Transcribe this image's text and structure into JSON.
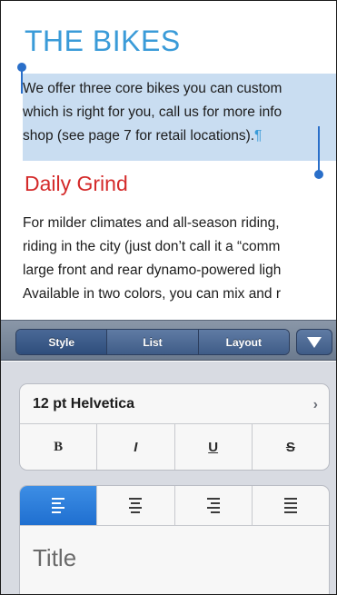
{
  "document": {
    "title": "THE BIKES",
    "paragraph1": [
      "We offer three core bikes you can custom",
      "which is right for you, call us for more info",
      "shop (see page 7 for retail locations)."
    ],
    "pilcrow": "¶",
    "heading": "Daily Grind",
    "paragraph2": [
      "For milder climates and all-season riding,",
      "riding in the city (just don’t call it a “comm",
      "large front and rear dynamo-powered ligh",
      "Available in two colors, you can mix and r"
    ]
  },
  "toolbar": {
    "tabs": [
      {
        "label": "Style",
        "active": true
      },
      {
        "label": "List",
        "active": false
      },
      {
        "label": "Layout",
        "active": false
      }
    ],
    "dropdown_icon": "triangle-down-icon"
  },
  "inspector": {
    "font_label": "12 pt Helvetica",
    "font_chevron": "›",
    "styles": [
      "B",
      "I",
      "U",
      "S"
    ],
    "alignment": [
      {
        "name": "align-left",
        "active": true
      },
      {
        "name": "align-center",
        "active": false
      },
      {
        "name": "align-right",
        "active": false
      },
      {
        "name": "align-justify",
        "active": false
      }
    ],
    "paragraph_style": "Title"
  },
  "colors": {
    "title": "#3a9bd8",
    "heading": "#d42a2a",
    "selection": "#c9ddf1",
    "accent": "#1f6fd0"
  }
}
